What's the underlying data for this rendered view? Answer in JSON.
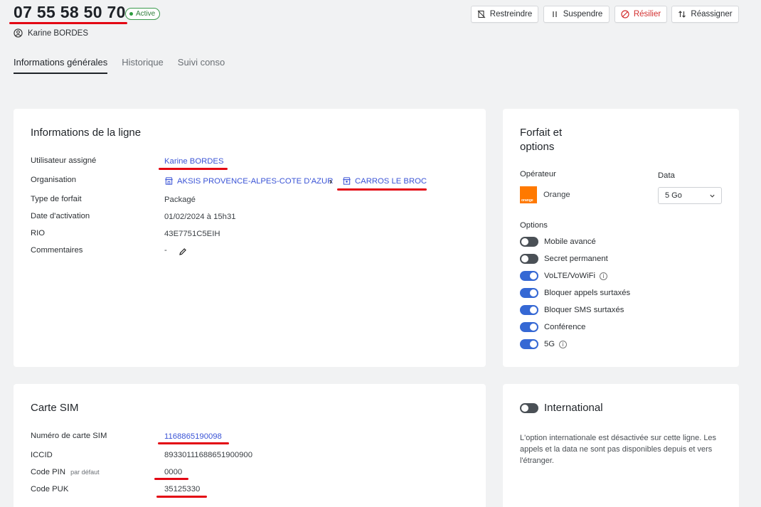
{
  "header": {
    "phone_number": "07 55 58 50 70",
    "status": "Active",
    "owner": "Karine BORDES",
    "actions": {
      "restrict": "Restreindre",
      "suspend": "Suspendre",
      "terminate": "Résilier",
      "reassign": "Réassigner"
    }
  },
  "tabs": [
    "Informations générales",
    "Historique",
    "Suivi conso"
  ],
  "line_info": {
    "title": "Informations de la ligne",
    "labels": {
      "user": "Utilisateur assigné",
      "organisation": "Organisation",
      "plan_type": "Type de forfait",
      "activation_date": "Date d'activation",
      "rio": "RIO",
      "comments": "Commentaires"
    },
    "values": {
      "user": "Karine BORDES",
      "org_parent": "AKSIS PROVENCE-ALPES-COTE D'AZUR",
      "org_child": "CARROS LE BROC",
      "plan_type": "Packagé",
      "activation_date": "01/02/2024 à 15h31",
      "rio": "43E7751C5EIH",
      "comments": "-"
    }
  },
  "plan": {
    "title_line1": "Forfait et",
    "title_line2": "options",
    "operator_label": "Opérateur",
    "operator": "Orange",
    "operator_logo_text": "orange",
    "data_label": "Data",
    "data_value": "5 Go",
    "options_label": "Options",
    "options": [
      {
        "label": "Mobile avancé",
        "on": false,
        "info": false
      },
      {
        "label": "Secret permanent",
        "on": false,
        "info": false
      },
      {
        "label": "VoLTE/VoWiFi",
        "on": true,
        "info": true
      },
      {
        "label": "Bloquer appels surtaxés",
        "on": true,
        "info": false
      },
      {
        "label": "Bloquer SMS surtaxés",
        "on": true,
        "info": false
      },
      {
        "label": "Conférence",
        "on": true,
        "info": false
      },
      {
        "label": "5G",
        "on": true,
        "info": true
      }
    ]
  },
  "sim": {
    "title": "Carte SIM",
    "labels": {
      "sim_number": "Numéro de carte SIM",
      "iccid": "ICCID",
      "pin": "Code PIN",
      "pin_note": "par défaut",
      "puk": "Code PUK"
    },
    "values": {
      "sim_number": "1168865190098",
      "iccid": "89330111688651900900",
      "pin": "0000",
      "puk": "35125330"
    }
  },
  "international": {
    "title": "International",
    "enabled": false,
    "description": "L'option internationale est désactivée sur cette ligne. Les appels et la data ne sont pas disponibles depuis et vers l'étranger."
  },
  "colors": {
    "accent": "#3b54d6",
    "toggle_on": "#3568d4",
    "toggle_off": "#4a5056",
    "danger": "#d32f2f",
    "annotation_red": "#e30613",
    "status_green": "#2e9c3f",
    "orange_brand": "#ff7900"
  }
}
